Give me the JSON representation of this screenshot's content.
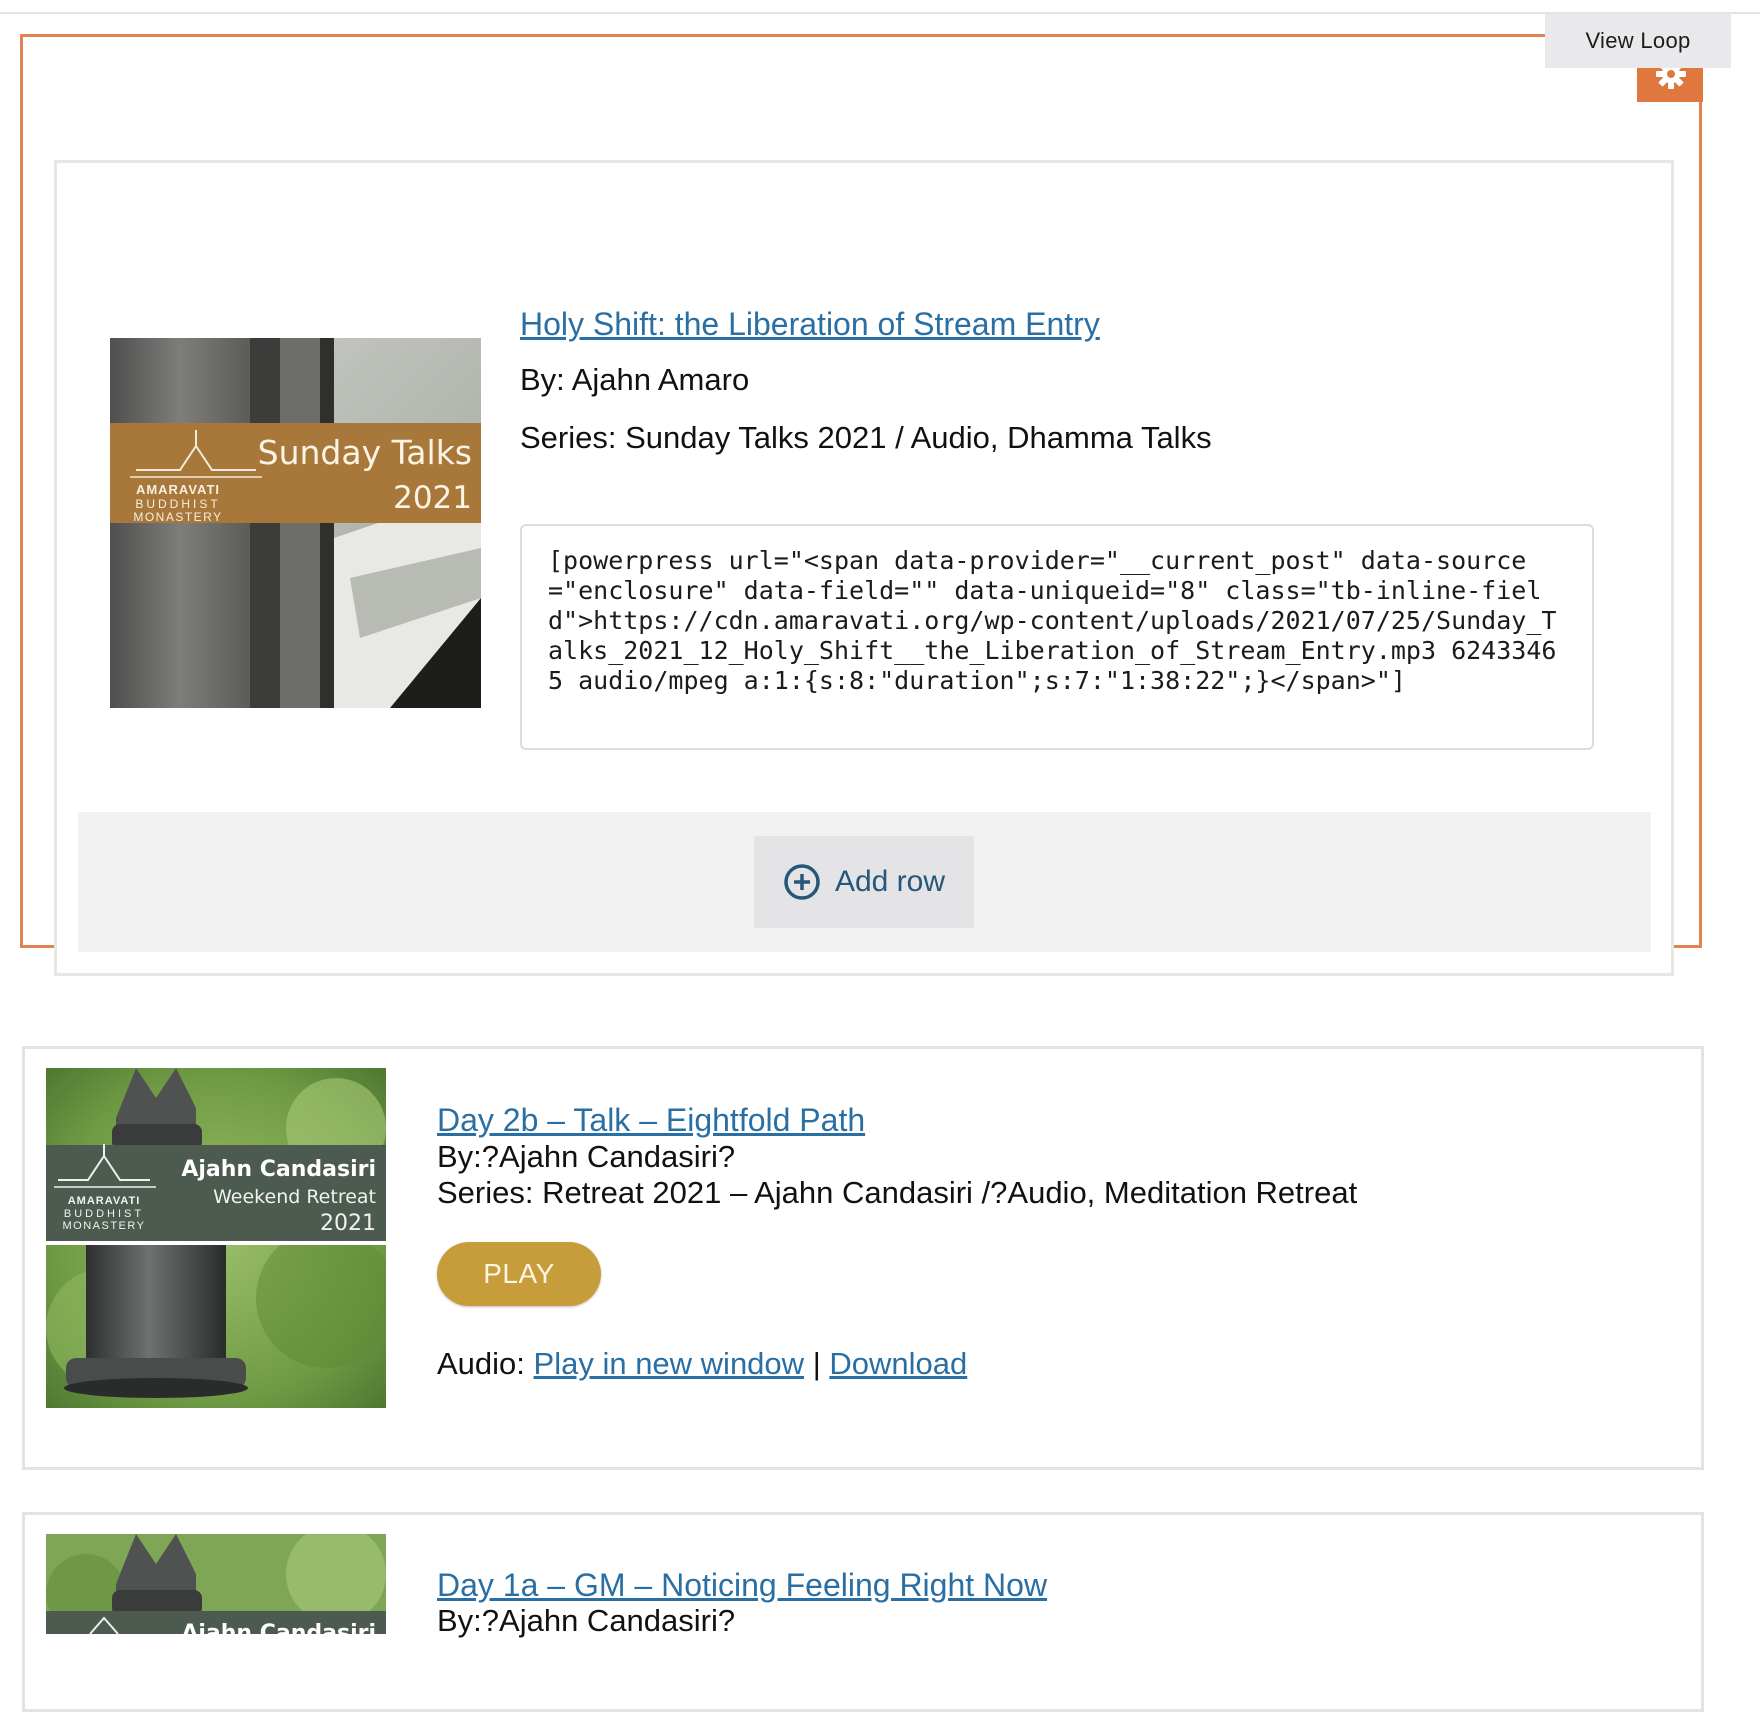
{
  "toolbar": {
    "view_loop_label": "View Loop"
  },
  "selected_post": {
    "title": "Holy Shift: the Liberation of Stream Entry",
    "by": "By: Ajahn Amaro",
    "series": "Series: Sunday Talks 2021 / Audio, Dhamma Talks",
    "thumbnail": {
      "logo_line1": "AMARAVATI",
      "logo_line2": "BUDDHIST",
      "logo_line3": "MONASTERY",
      "banner_title": "Sunday Talks",
      "banner_year": "2021"
    },
    "shortcode": "[powerpress url=\"<span data-provider=\"__current_post\" data-source=\"enclosure\" data-field=\"\" data-uniqueid=\"8\" class=\"tb-inline-field\">https://cdn.amaravati.org/wp-content/uploads/2021/07/25/Sunday_Talks_2021_12_Holy_Shift__the_Liberation_of_Stream_Entry.mp3 62433465 audio/mpeg a:1:{s:8:\"duration\";s:7:\"1:38:22\";}</span>\"]"
  },
  "add_row": {
    "label": "Add row"
  },
  "posts": [
    {
      "title": "Day 2b – Talk – Eightfold Path",
      "by": "By:?Ajahn Candasiri?",
      "series": "Series: Retreat 2021 – Ajahn Candasiri /?Audio, Meditation Retreat",
      "play_label": "PLAY",
      "audio_label": "Audio:",
      "play_new_window": "Play in new window",
      "separator": "|",
      "download": "Download",
      "thumbnail": {
        "logo_line1": "AMARAVATI",
        "logo_line2": "BUDDHIST",
        "logo_line3": "MONASTERY",
        "banner_title": "Ajahn Candasiri",
        "banner_subtitle": "Weekend Retreat",
        "banner_year": "2021"
      }
    },
    {
      "title": "Day 1a – GM – Noticing Feeling Right Now",
      "by": "By:?Ajahn Candasiri?",
      "thumbnail": {
        "banner_title": "Ajahn Candasiri"
      }
    }
  ],
  "colors": {
    "selection_border": "#e38150",
    "gear_tab": "#e0773f",
    "link": "#2a6fa4",
    "play_button": "#c79d3c",
    "sunday_banner": "#a7783a",
    "retreat_banner": "#4c5a4f"
  }
}
